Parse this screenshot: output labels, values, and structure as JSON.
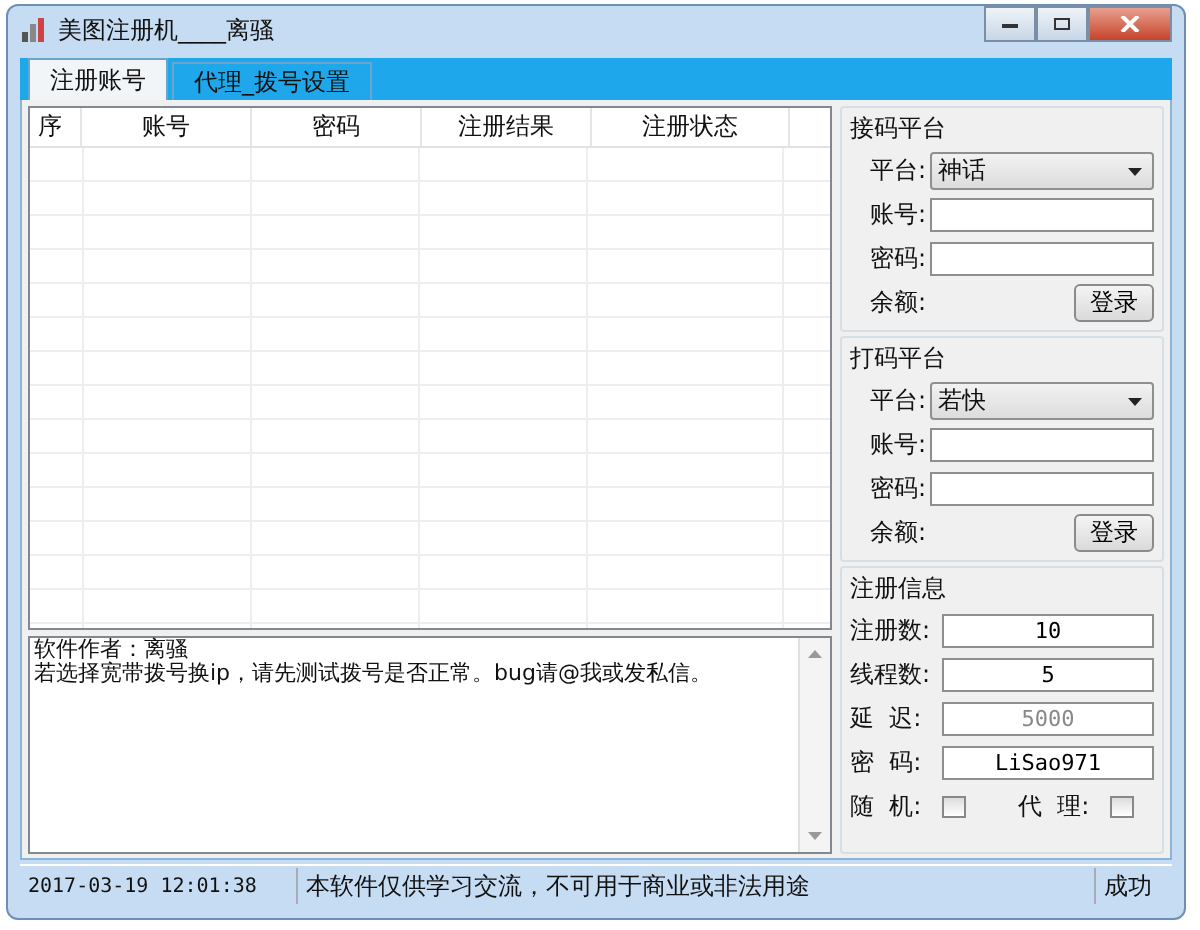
{
  "window": {
    "title": "美图注册机____离骚"
  },
  "tabs": [
    {
      "label": "注册账号",
      "selected": true
    },
    {
      "label": "代理_拨号设置",
      "selected": false
    }
  ],
  "table": {
    "columns": [
      "序",
      "账号",
      "密码",
      "注册结果",
      "注册状态"
    ]
  },
  "log": {
    "lines": [
      "软件作者：离骚",
      "若选择宽带拨号换ip，请先测试拨号是否正常。bug请@我或发私信。"
    ]
  },
  "platforms": [
    {
      "title": "接码平台",
      "platform_label": "平台:",
      "platform_value": "神话",
      "account_label": "账号:",
      "password_label": "密码:",
      "balance_label": "余额:",
      "login_button": "登录"
    },
    {
      "title": "打码平台",
      "platform_label": "平台:",
      "platform_value": "若快",
      "account_label": "账号:",
      "password_label": "密码:",
      "balance_label": "余额:",
      "login_button": "登录"
    }
  ],
  "register_info": {
    "title": "注册信息",
    "fields": [
      {
        "label": "注册数:",
        "value": "10",
        "disabled": false
      },
      {
        "label": "线程数:",
        "value": "5",
        "disabled": false
      },
      {
        "label": "延  迟:",
        "value": "5000",
        "disabled": true
      },
      {
        "label": "密  码:",
        "value": "LiSao971",
        "disabled": false
      }
    ],
    "checkboxes": [
      {
        "label": "随  机:",
        "checked": false
      },
      {
        "label": "代  理:",
        "checked": false
      }
    ]
  },
  "status_bar": {
    "time": "2017-03-19 12:01:38",
    "notice": "本软件仅供学习交流，不可用于商业或非法用途",
    "status": "成功"
  }
}
